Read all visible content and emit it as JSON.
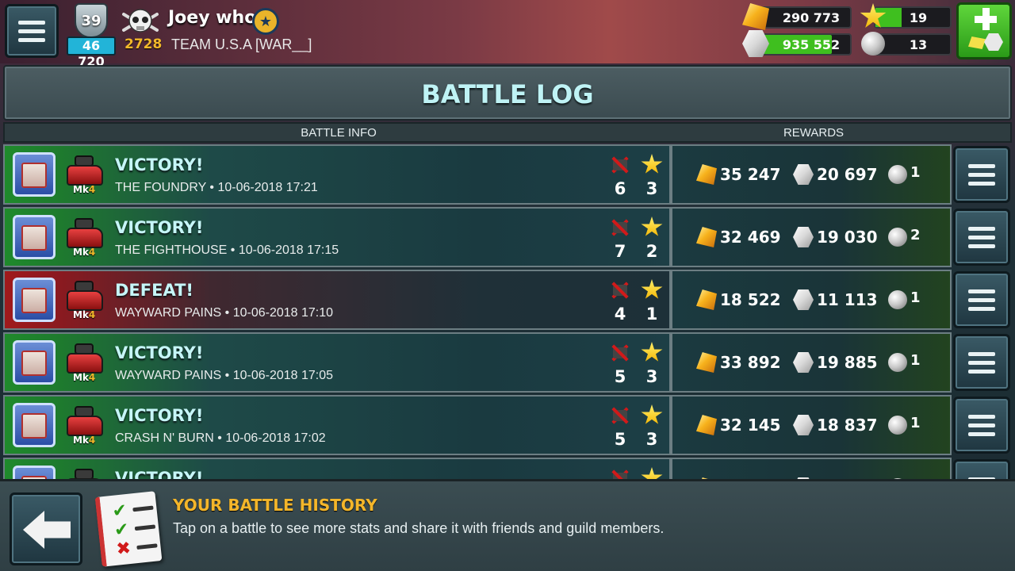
{
  "header": {
    "level": "39",
    "xp": "46 720",
    "trophies": "2728",
    "player_name": "Joey who",
    "team": "TEAM U.S.A [WAR__]",
    "gold": "290 773",
    "silver": "935 552",
    "stars": "19",
    "pearls": "13",
    "stars_progress_fraction": 0.35
  },
  "title": "BATTLE LOG",
  "columns": {
    "battle_info": "BATTLE INFO",
    "rewards": "REWARDS"
  },
  "battles": [
    {
      "result": "VICTORY!",
      "map": "THE FOUNDRY • 10-06-2018 17:21",
      "mk": "Mk",
      "mk_level": "4",
      "kills": "6",
      "stars": "3",
      "gold": "35 247",
      "silver": "20 697",
      "pearls": "1"
    },
    {
      "result": "VICTORY!",
      "map": "THE FIGHTHOUSE • 10-06-2018 17:15",
      "mk": "Mk",
      "mk_level": "4",
      "kills": "7",
      "stars": "2",
      "gold": "32 469",
      "silver": "19 030",
      "pearls": "2"
    },
    {
      "result": "DEFEAT!",
      "map": "WAYWARD PAINS • 10-06-2018 17:10",
      "mk": "Mk",
      "mk_level": "4",
      "kills": "4",
      "stars": "1",
      "gold": "18 522",
      "silver": "11 113",
      "pearls": "1"
    },
    {
      "result": "VICTORY!",
      "map": "WAYWARD PAINS • 10-06-2018 17:05",
      "mk": "Mk",
      "mk_level": "4",
      "kills": "5",
      "stars": "3",
      "gold": "33 892",
      "silver": "19 885",
      "pearls": "1"
    },
    {
      "result": "VICTORY!",
      "map": "CRASH N' BURN • 10-06-2018 17:02",
      "mk": "Mk",
      "mk_level": "4",
      "kills": "5",
      "stars": "3",
      "gold": "32 145",
      "silver": "18 837",
      "pearls": "1"
    },
    {
      "result": "VICTORY!",
      "map": "",
      "mk": "",
      "mk_level": "",
      "kills": "",
      "stars": "",
      "gold": "",
      "silver": "",
      "pearls": ""
    }
  ],
  "footer": {
    "tip_title": "YOUR BATTLE HISTORY",
    "tip_text": "Tap on a battle to see more stats and share it with friends and guild members."
  },
  "icons": {
    "menu": "hamburger-icon",
    "gold": "gold-nugget-icon",
    "silver": "silver-gem-icon",
    "star": "star-icon",
    "pearl": "pearl-icon",
    "kill": "crossed-tank-icon",
    "back": "back-arrow-icon",
    "checklist": "checklist-icon"
  }
}
